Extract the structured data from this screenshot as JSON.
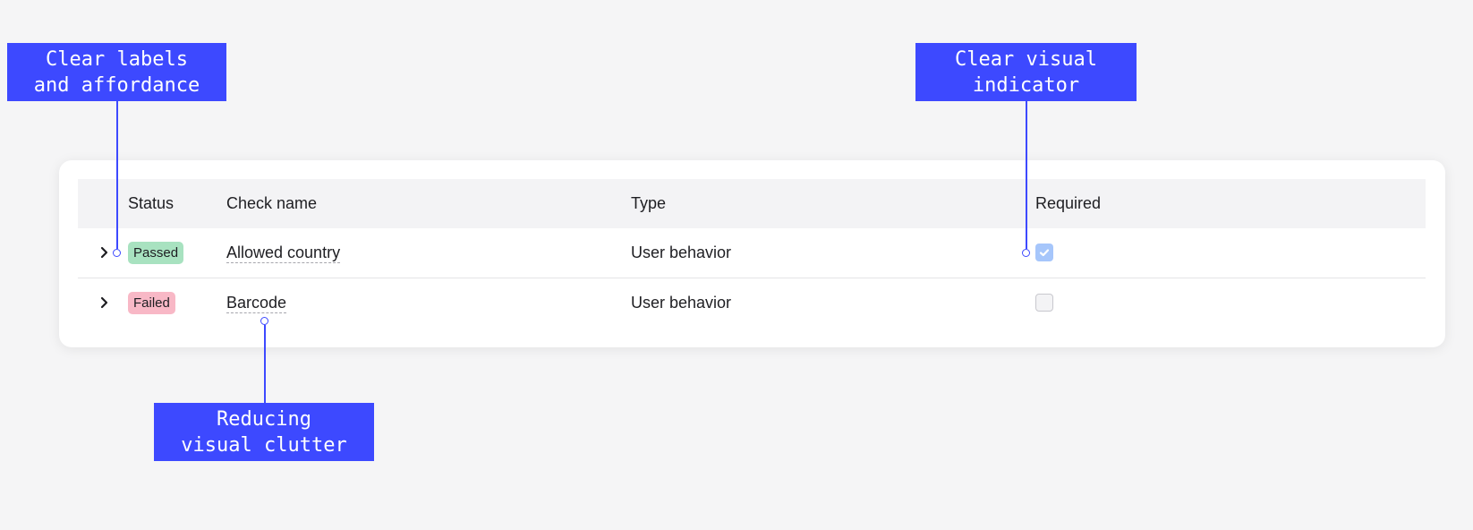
{
  "table": {
    "columns": [
      "Status",
      "Check name",
      "Type",
      "Required"
    ],
    "rows": [
      {
        "status": "Passed",
        "check_name": "Allowed country",
        "type": "User behavior",
        "required": true
      },
      {
        "status": "Failed",
        "check_name": "Barcode",
        "type": "User behavior",
        "required": false
      }
    ]
  },
  "annotations": {
    "labels_affordance": "Clear labels\nand affordance",
    "visual_indicator": "Clear visual\nindicator",
    "visual_clutter": "Reducing\nvisual clutter"
  },
  "colors": {
    "accent": "#3d49ff",
    "passed_badge": "#a8e2c0",
    "failed_badge": "#f8b8c6",
    "checkbox_checked": "#a6c6fb"
  }
}
